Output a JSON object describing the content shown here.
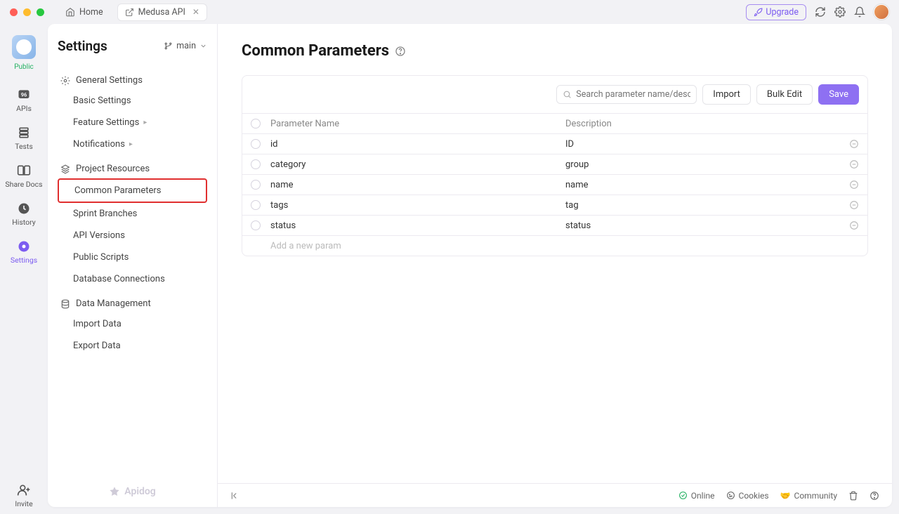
{
  "titlebar": {
    "home": "Home",
    "tab": "Medusa API",
    "upgrade": "Upgrade"
  },
  "rail": {
    "public": "Public",
    "apis": "APIs",
    "tests": "Tests",
    "share": "Share Docs",
    "history": "History",
    "settings": "Settings",
    "invite": "Invite"
  },
  "panel": {
    "title": "Settings",
    "branch": "main",
    "sec_general": "General Settings",
    "basic": "Basic Settings",
    "feature": "Feature Settings",
    "notifications": "Notifications",
    "sec_resources": "Project Resources",
    "common_params": "Common Parameters",
    "sprint": "Sprint Branches",
    "api_versions": "API Versions",
    "public_scripts": "Public Scripts",
    "database": "Database Connections",
    "sec_data": "Data Management",
    "import": "Import Data",
    "export": "Export Data",
    "footer": "Apidog"
  },
  "main": {
    "title": "Common Parameters",
    "search_ph": "Search parameter name/descri…",
    "import": "Import",
    "bulk": "Bulk Edit",
    "save": "Save",
    "col_name": "Parameter Name",
    "col_desc": "Description",
    "add_new": "Add a new param",
    "rows": [
      {
        "name": "id",
        "desc": "ID"
      },
      {
        "name": "category",
        "desc": "group"
      },
      {
        "name": "name",
        "desc": "name"
      },
      {
        "name": "tags",
        "desc": "tag"
      },
      {
        "name": "status",
        "desc": "status"
      }
    ]
  },
  "status": {
    "online": "Online",
    "cookies": "Cookies",
    "community": "Community"
  }
}
